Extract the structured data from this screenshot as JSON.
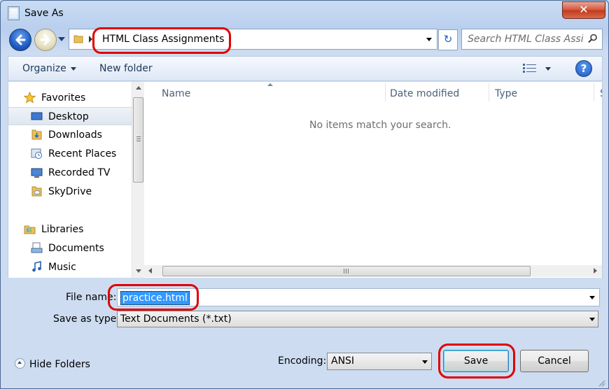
{
  "window": {
    "title": "Save As",
    "close_glyph": "✕"
  },
  "nav": {
    "address": "HTML Class Assignments",
    "search_placeholder": "Search HTML Class Assi...",
    "refresh_glyph": "↻"
  },
  "toolbar": {
    "organize": "Organize",
    "new_folder": "New folder",
    "help": "?"
  },
  "sidebar": {
    "items": [
      {
        "label": "Favorites",
        "icon": "star-icon"
      },
      {
        "label": "Desktop",
        "icon": "desktop-icon"
      },
      {
        "label": "Downloads",
        "icon": "downloads-folder-icon"
      },
      {
        "label": "Recent Places",
        "icon": "recent-places-icon"
      },
      {
        "label": "Recorded TV",
        "icon": "recorded-tv-icon"
      },
      {
        "label": "SkyDrive",
        "icon": "skydrive-folder-icon"
      },
      {
        "label": "Libraries",
        "icon": "libraries-icon"
      },
      {
        "label": "Documents",
        "icon": "documents-icon"
      },
      {
        "label": "Music",
        "icon": "music-icon"
      }
    ]
  },
  "filelist": {
    "columns": [
      "Name",
      "Date modified",
      "Type",
      "S"
    ],
    "empty_message": "No items match your search."
  },
  "form": {
    "file_name_label": "File name:",
    "file_name_value": "practice.html",
    "save_as_type_label": "Save as type:",
    "save_as_type_value": "Text Documents (*.txt)",
    "encoding_label": "Encoding:",
    "encoding_value": "ANSI"
  },
  "footer": {
    "hide_folders": "Hide Folders",
    "save": "Save",
    "cancel": "Cancel"
  },
  "colors": {
    "annotation_red": "#e00000",
    "selection_blue": "#3399ff"
  }
}
